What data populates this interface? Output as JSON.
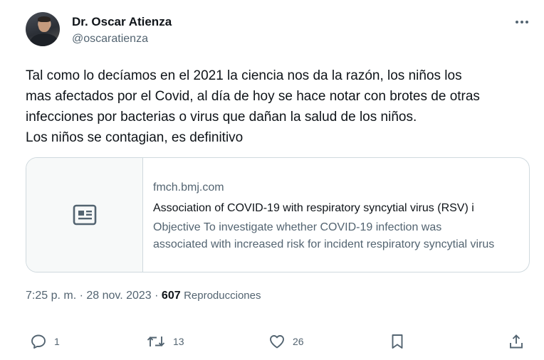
{
  "author": {
    "name": "Dr. Oscar Atienza",
    "handle": "@oscaratienza"
  },
  "tweet": {
    "lines": [
      "Tal como lo decíamos en el 2021 la ciencia nos da la razón, los niños los",
      "mas afectados por el Covid, al día de hoy se hace notar con brotes de otras",
      "infecciones por bacterias o virus que dañan la salud de los niños.",
      "Los niños se contagian, es definitivo"
    ]
  },
  "link_card": {
    "domain": "fmch.bmj.com",
    "title": "Association of COVID-19 with respiratory syncytial virus (RSV) i",
    "description_lines": [
      "Objective To investigate whether COVID-19 infection was",
      "associated with increased risk for incident respiratory syncytial virus"
    ]
  },
  "meta": {
    "time_date": "7:25 p. m. · 28 nov. 2023 · ",
    "views_count": "607",
    "views_label": "Reproducciones"
  },
  "actions": {
    "reply_count": "1",
    "retweet_count": "13",
    "like_count": "26"
  },
  "icons": {
    "more": "more-horizontal-icon",
    "card_placeholder": "article-icon",
    "reply": "comment-icon",
    "retweet": "retweet-icon",
    "like": "heart-icon",
    "bookmark": "bookmark-icon",
    "share": "share-icon"
  },
  "colors": {
    "text_primary": "#0f1419",
    "text_secondary": "#536471",
    "border": "#cfd9de"
  }
}
